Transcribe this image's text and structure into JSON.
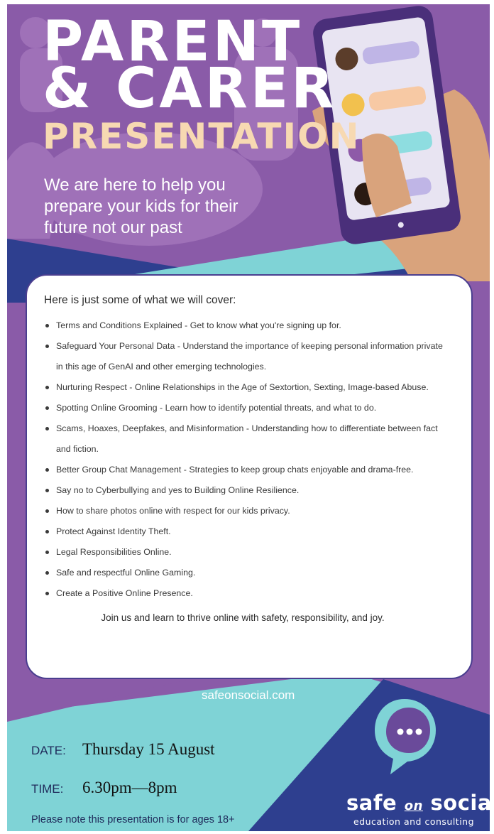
{
  "header": {
    "title_line1": "PARENT",
    "title_line2": "& CARER",
    "title_line3": "PRESENTATION",
    "tagline": "We are here to help you prepare your kids for their future not our past"
  },
  "card": {
    "heading": "Here is just some of what we will cover:",
    "items": [
      "Terms and Conditions Explained -  Get to know what you're signing up for.",
      "Safeguard Your Personal Data - Understand the importance of keeping personal information private in this age of GenAI and other emerging technologies.",
      "Nurturing Respect - Online Relationships in the Age of Sextortion, Sexting, Image-based Abuse.",
      "Spotting Online Grooming - Learn how to identify potential threats, and what to do.",
      "Scams, Hoaxes, Deepfakes, and Misinformation - Understanding how to differentiate between fact and fiction.",
      "Better Group Chat Management - Strategies to keep group chats enjoyable and drama-free.",
      "Say no to Cyberbullying and yes to Building Online Resilience.",
      "How to share photos online with respect for our kids privacy.",
      "Protect Against Identity Theft.",
      "Legal Responsibilities Online.",
      "Safe and respectful Online Gaming.",
      "Create a Positive Online Presence."
    ],
    "closing": "Join us and learn to thrive online with safety, responsibility, and joy."
  },
  "footer": {
    "url": "safeonsocial.com",
    "date_label": "DATE:",
    "date_value": "Thursday 15 August",
    "time_label": "TIME:",
    "time_value": "6.30pm—8pm",
    "age_note": "Please note this presentation is for ages 18+"
  },
  "logo": {
    "word_safe": "safe",
    "word_on": "on",
    "word_social": "social",
    "tagline": "education and consulting",
    "icon": "speech-bubble-ellipsis-icon"
  },
  "colors": {
    "purple": "#8a5ba8",
    "navy": "#2e3f8f",
    "teal": "#7fd3d6",
    "peach": "#f7d9b2",
    "white": "#ffffff"
  }
}
